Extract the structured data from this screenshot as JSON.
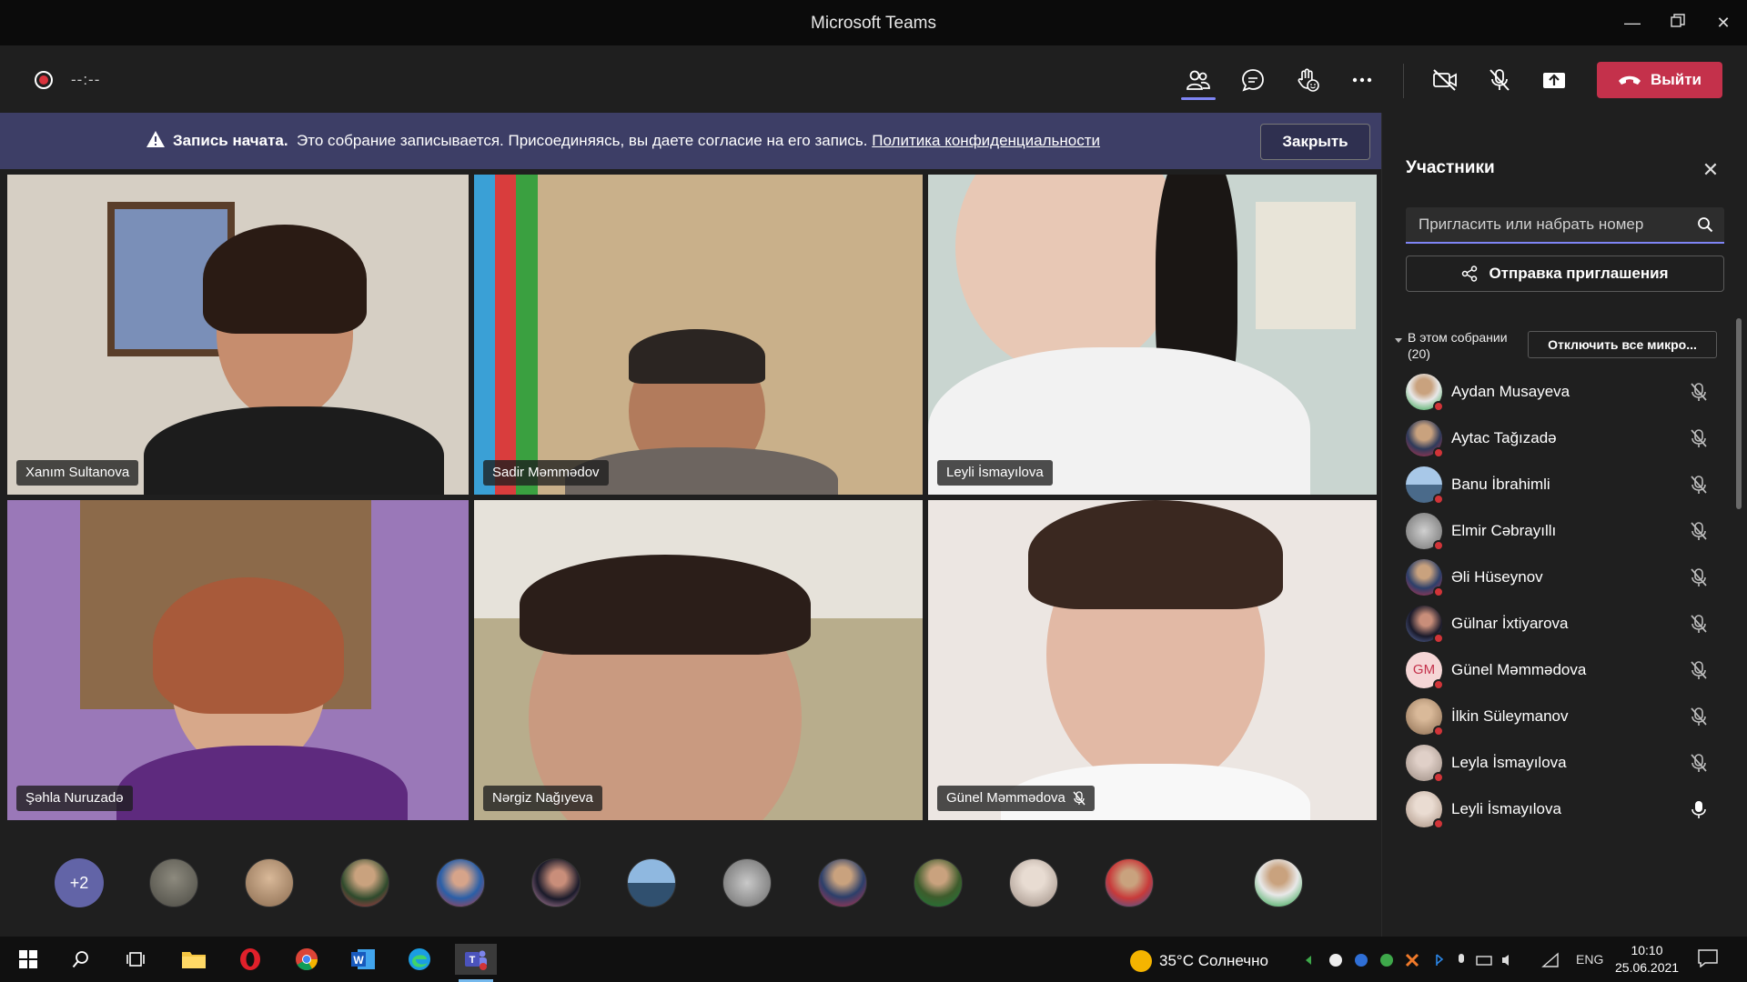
{
  "window": {
    "title": "Microsoft Teams"
  },
  "call": {
    "timer": "--:--",
    "leave_label": "Выйти"
  },
  "banner": {
    "bold": "Запись начата.",
    "text": "Это собрание записывается. Присоединяясь, вы даете согласие на его запись.",
    "link": "Политика конфиденциальности",
    "close_label": "Закрыть"
  },
  "tiles": [
    {
      "name": "Xanım Sultanova",
      "muted": false
    },
    {
      "name": "Sadir Məmmədov",
      "muted": false
    },
    {
      "name": "Leyli İsmayılova",
      "muted": false
    },
    {
      "name": "Şəhla Nuruzadə",
      "muted": false
    },
    {
      "name": "Nərgiz Nağıyeva",
      "muted": false
    },
    {
      "name": "Günel Məmmədova",
      "muted": true
    }
  ],
  "strip": {
    "more_label": "+2"
  },
  "panel": {
    "title": "Участники",
    "search_placeholder": "Пригласить или набрать номер",
    "invite_label": "Отправка приглашения",
    "section_label": "В этом собрании",
    "section_count": "(20)",
    "mute_all_label": "Отключить все микро...",
    "participants": [
      {
        "name": "Aydan Musayeva",
        "muted": true
      },
      {
        "name": "Aytac Tağızadə",
        "muted": true
      },
      {
        "name": "Banu İbrahimli",
        "muted": true
      },
      {
        "name": "Elmir Cəbrayıllı",
        "muted": true
      },
      {
        "name": "Əli Hüseynov",
        "muted": true
      },
      {
        "name": "Gülnar İxtiyarova",
        "muted": true
      },
      {
        "name": "Günel Məmmədova",
        "muted": true,
        "initials": "GM"
      },
      {
        "name": "İlkin Süleymanov",
        "muted": true
      },
      {
        "name": "Leyla İsmayılova",
        "muted": true
      },
      {
        "name": "Leyli İsmayılova",
        "muted": false
      }
    ]
  },
  "taskbar": {
    "weather": "35°C Солнечно",
    "lang": "ENG",
    "time": "10:10",
    "date": "25.06.2021"
  },
  "colors": {
    "accent": "#6264a7",
    "leave": "#c4314b",
    "banner": "#3d3e66",
    "status_busy": "#d13438"
  }
}
